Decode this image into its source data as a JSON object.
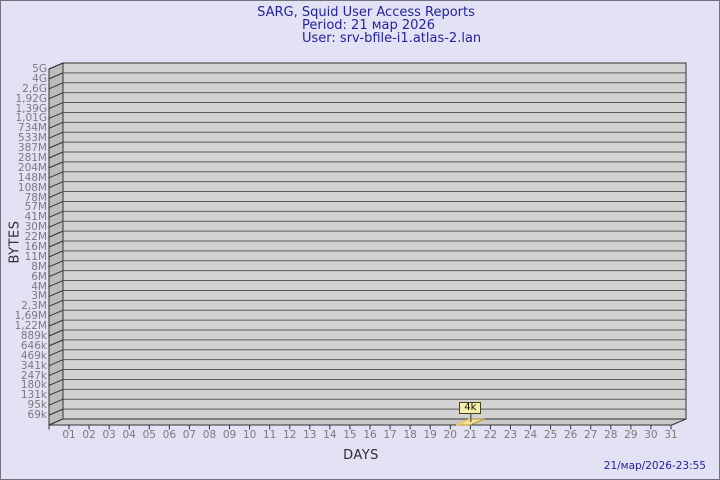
{
  "title": {
    "line1": "SARG, Squid User Access Reports",
    "line2": "Period: 21 мар 2026",
    "line3": "User: srv-bfile-i1.atlas-2.lan"
  },
  "footer": {
    "timestamp": "21/мар/2026-23:55"
  },
  "chart_data": {
    "type": "bar",
    "title": "SARG, Squid User Access Reports",
    "subtitle": "Period: 21 мар 2026",
    "user": "srv-bfile-i1.atlas-2.lan",
    "xlabel": "DAYS",
    "ylabel": "BYTES",
    "y_scale": "log-like tick ladder",
    "y_tick_labels": [
      "5G",
      "4G",
      "2,6G",
      "1,92G",
      "1,39G",
      "1,01G",
      "734M",
      "533M",
      "387M",
      "281M",
      "204M",
      "148M",
      "108M",
      "78M",
      "57M",
      "41M",
      "30M",
      "22M",
      "16M",
      "11M",
      "8M",
      "6M",
      "4M",
      "3M",
      "2,3M",
      "1,69M",
      "1,22M",
      "889k",
      "646k",
      "469k",
      "341k",
      "247k",
      "180k",
      "131k",
      "95k",
      "69k"
    ],
    "x_tick_labels": [
      "01",
      "02",
      "03",
      "04",
      "05",
      "06",
      "07",
      "08",
      "09",
      "10",
      "11",
      "12",
      "13",
      "14",
      "15",
      "16",
      "17",
      "18",
      "19",
      "20",
      "21",
      "22",
      "23",
      "24",
      "25",
      "26",
      "27",
      "28",
      "29",
      "30",
      "31"
    ],
    "values": [
      0,
      0,
      0,
      0,
      0,
      0,
      0,
      0,
      0,
      0,
      0,
      0,
      0,
      0,
      0,
      0,
      0,
      0,
      0,
      0,
      4096,
      0,
      0,
      0,
      0,
      0,
      0,
      0,
      0,
      0,
      0
    ],
    "annotation": {
      "day": "21",
      "label": "4k"
    },
    "legend": "none",
    "grid": "horizontal only, 3d-wall chart"
  },
  "colors": {
    "background": "#e2e2f4",
    "title_text": "#23239c",
    "face": "#d2d2d2",
    "wall": "#bcbcbc",
    "floor": "#c9c9c9",
    "grid": "#5c5c5c",
    "frame": "#333333",
    "tick_label": "#7b7b7b",
    "axis_title": "#2e2e2e",
    "bar_fill": "#f2e49a",
    "bar_edge": "#b09a30",
    "bar_highlight": "#e9cd5e",
    "flag_fill": "#f2eeae",
    "flag_border": "#45451a"
  }
}
